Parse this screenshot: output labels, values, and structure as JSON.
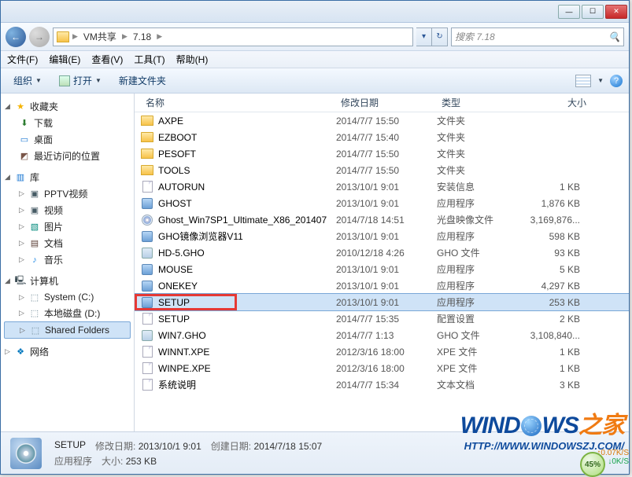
{
  "titlebar": {
    "min": "—",
    "max": "☐",
    "close": "✕"
  },
  "nav": {
    "back": "←",
    "fwd": "→",
    "path": [
      "VM共享",
      "7.18"
    ],
    "dropdown": "▾",
    "refresh": "↻",
    "search_placeholder": "搜索 7.18",
    "search_icon": "🔍"
  },
  "menu": {
    "file": "文件(F)",
    "edit": "编辑(E)",
    "view": "查看(V)",
    "tools": "工具(T)",
    "help": "帮助(H)"
  },
  "toolbar": {
    "organize": "组织",
    "open": "打开",
    "newfolder": "新建文件夹"
  },
  "sidebar": {
    "favorites": {
      "label": "收藏夹",
      "items": [
        "下载",
        "桌面",
        "最近访问的位置"
      ]
    },
    "libraries": {
      "label": "库",
      "items": [
        "PPTV视频",
        "视频",
        "图片",
        "文档",
        "音乐"
      ]
    },
    "computer": {
      "label": "计算机",
      "items": [
        "System (C:)",
        "本地磁盘 (D:)",
        "Shared Folders"
      ]
    },
    "network": {
      "label": "网络"
    }
  },
  "columns": {
    "name": "名称",
    "date": "修改日期",
    "type": "类型",
    "size": "大小"
  },
  "files": [
    {
      "name": "AXPE",
      "date": "2014/7/7 15:50",
      "type": "文件夹",
      "size": "",
      "icon": "folder"
    },
    {
      "name": "EZBOOT",
      "date": "2014/7/7 15:40",
      "type": "文件夹",
      "size": "",
      "icon": "folder"
    },
    {
      "name": "PESOFT",
      "date": "2014/7/7 15:50",
      "type": "文件夹",
      "size": "",
      "icon": "folder"
    },
    {
      "name": "TOOLS",
      "date": "2014/7/7 15:50",
      "type": "文件夹",
      "size": "",
      "icon": "folder"
    },
    {
      "name": "AUTORUN",
      "date": "2013/10/1 9:01",
      "type": "安装信息",
      "size": "1 KB",
      "icon": "file"
    },
    {
      "name": "GHOST",
      "date": "2013/10/1 9:01",
      "type": "应用程序",
      "size": "1,876 KB",
      "icon": "exe"
    },
    {
      "name": "Ghost_Win7SP1_Ultimate_X86_201407",
      "date": "2014/7/18 14:51",
      "type": "光盘映像文件",
      "size": "3,169,876...",
      "icon": "disc"
    },
    {
      "name": "GHO镜像浏览器V11",
      "date": "2013/10/1 9:01",
      "type": "应用程序",
      "size": "598 KB",
      "icon": "exe"
    },
    {
      "name": "HD-5.GHO",
      "date": "2010/12/18 4:26",
      "type": "GHO 文件",
      "size": "93 KB",
      "icon": "gho"
    },
    {
      "name": "MOUSE",
      "date": "2013/10/1 9:01",
      "type": "应用程序",
      "size": "5 KB",
      "icon": "exe"
    },
    {
      "name": "ONEKEY",
      "date": "2013/10/1 9:01",
      "type": "应用程序",
      "size": "4,297 KB",
      "icon": "exe"
    },
    {
      "name": "SETUP",
      "date": "2013/10/1 9:01",
      "type": "应用程序",
      "size": "253 KB",
      "icon": "exe",
      "selected": true,
      "highlighted": true
    },
    {
      "name": "SETUP",
      "date": "2014/7/7 15:35",
      "type": "配置设置",
      "size": "2 KB",
      "icon": "file"
    },
    {
      "name": "WIN7.GHO",
      "date": "2014/7/7 1:13",
      "type": "GHO 文件",
      "size": "3,108,840...",
      "icon": "gho"
    },
    {
      "name": "WINNT.XPE",
      "date": "2012/3/16 18:00",
      "type": "XPE 文件",
      "size": "1 KB",
      "icon": "file"
    },
    {
      "name": "WINPE.XPE",
      "date": "2012/3/16 18:00",
      "type": "XPE 文件",
      "size": "1 KB",
      "icon": "file"
    },
    {
      "name": "系统说明",
      "date": "2014/7/7 15:34",
      "type": "文本文档",
      "size": "3 KB",
      "icon": "file"
    }
  ],
  "status": {
    "name": "SETUP",
    "mod_label": "修改日期:",
    "mod_value": "2013/10/1 9:01",
    "create_label": "创建日期:",
    "create_value": "2014/7/18 15:07",
    "type_value": "应用程序",
    "size_label": "大小:",
    "size_value": "253 KB"
  },
  "watermark": {
    "part1": "WIND",
    "part2": "WS",
    "suffix": "之家",
    "url": "HTTP://WWW.WINDOWSZJ.COM/"
  },
  "meter": {
    "up": "0.07K/S",
    "down": "0K/S",
    "pct": "45%"
  }
}
